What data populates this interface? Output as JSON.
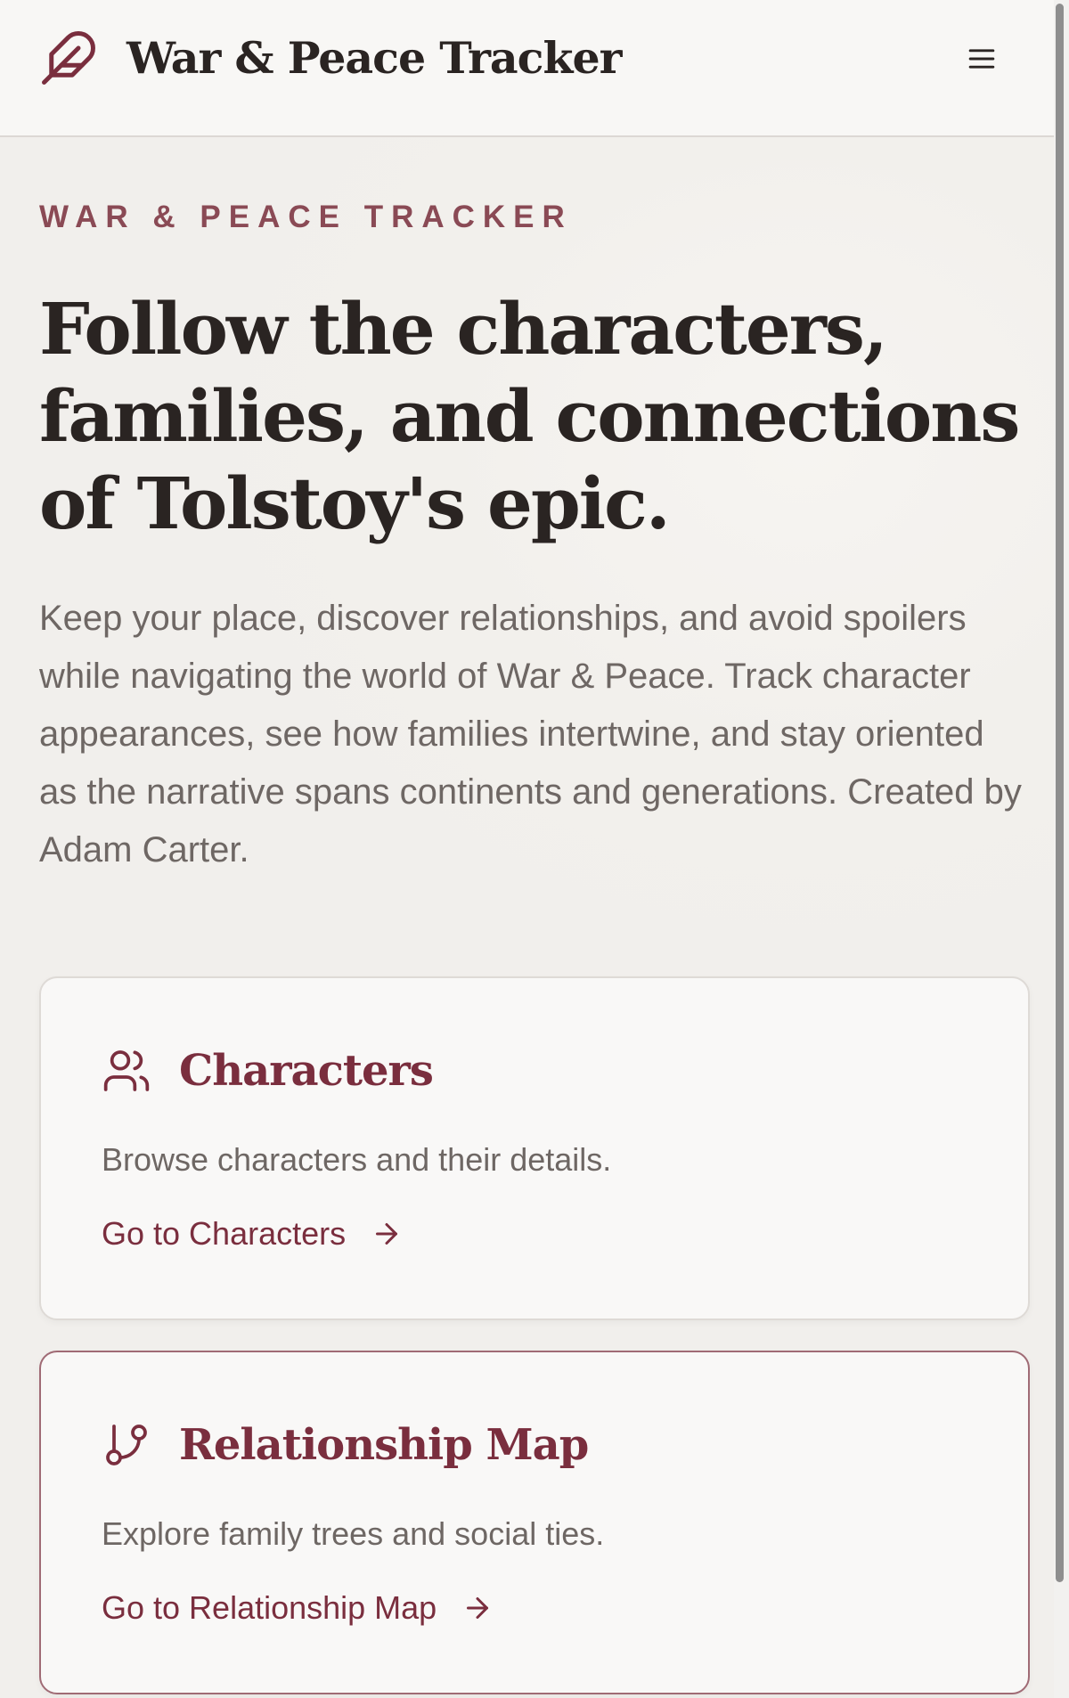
{
  "header": {
    "brand_name": "War & Peace Tracker",
    "brand_icon": "feather-icon",
    "menu_icon": "hamburger-menu-icon"
  },
  "hero": {
    "eyebrow": "WAR & PEACE TRACKER",
    "title": "Follow the characters, families, and connections of Tolstoy's epic.",
    "description": "Keep your place, discover relationships, and avoid spoilers while navigating the world of War & Peace. Track character appearances, see how families intertwine, and stay oriented as the narrative spans continents and generations. Created by Adam Carter."
  },
  "cards": [
    {
      "icon": "users-icon",
      "title": "Characters",
      "description": "Browse characters and their details.",
      "link_label": "Go to Characters",
      "link_icon": "arrow-right-icon"
    },
    {
      "icon": "git-branch-icon",
      "title": "Relationship Map",
      "description": "Explore family trees and social ties.",
      "link_label": "Go to Relationship Map",
      "link_icon": "arrow-right-icon"
    }
  ],
  "colors": {
    "accent": "#7a2e3e",
    "eyebrow": "#8a4a55",
    "text": "#2a2422",
    "muted": "#6e6764",
    "background": "#f2f0ec"
  }
}
